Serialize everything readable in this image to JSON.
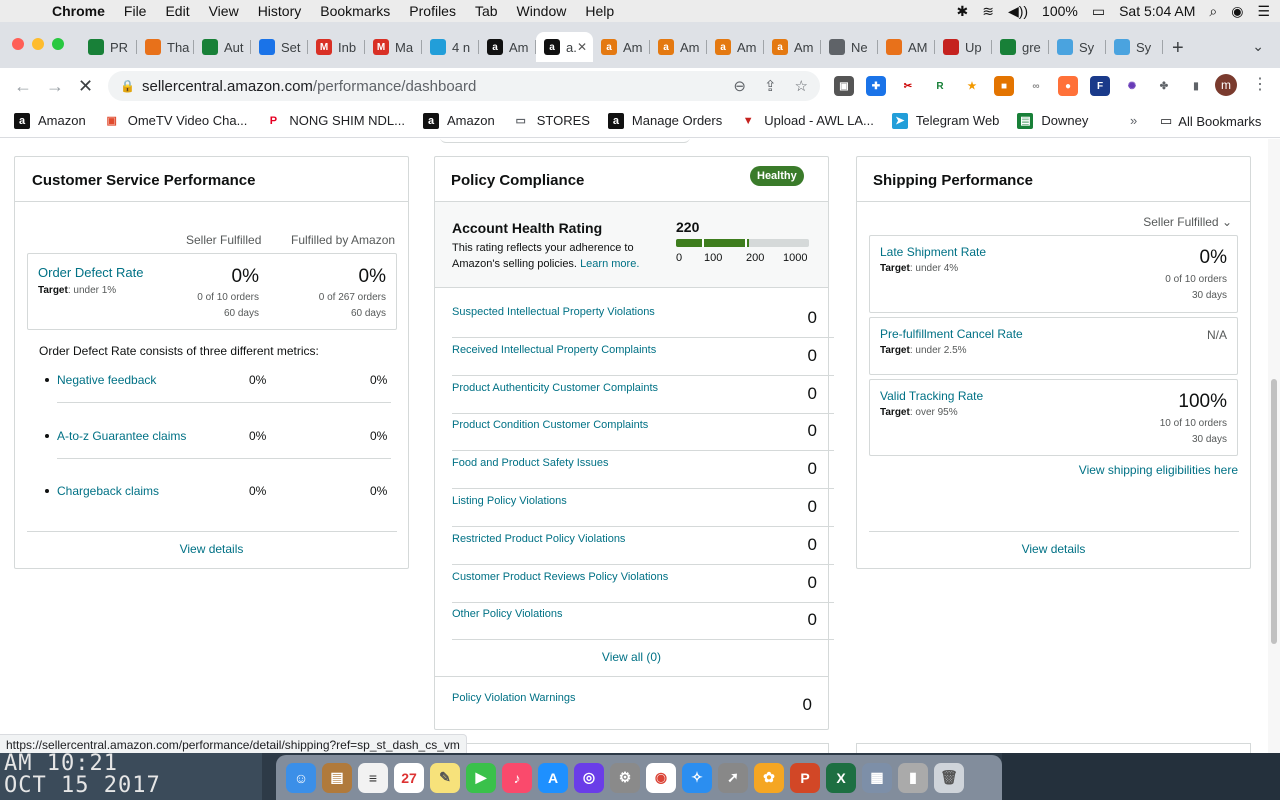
{
  "menubar": {
    "app": "Chrome",
    "items": [
      "File",
      "Edit",
      "View",
      "History",
      "Bookmarks",
      "Profiles",
      "Tab",
      "Window",
      "Help"
    ],
    "battery": "100%",
    "clock": "Sat 5:04 AM"
  },
  "tabs": [
    {
      "label": "PR",
      "icon": "sheets-icon",
      "color": "#188038"
    },
    {
      "label": "Tha",
      "icon": "pen-icon",
      "color": "#e8711a"
    },
    {
      "label": "Aut",
      "icon": "sheets-icon",
      "color": "#188038"
    },
    {
      "label": "Set",
      "icon": "gear-icon",
      "color": "#1a73e8"
    },
    {
      "label": "Inb",
      "icon": "gmail-icon",
      "color": "#d93025"
    },
    {
      "label": "Ma",
      "icon": "gmail-icon",
      "color": "#d93025"
    },
    {
      "label": "4 n",
      "icon": "telegram-icon",
      "color": "#229ed9"
    },
    {
      "label": "Am",
      "icon": "amazon-icon",
      "color": "#111111"
    },
    {
      "label": "a.",
      "icon": "amazon-icon",
      "color": "#111111",
      "active": true
    },
    {
      "label": "Am",
      "icon": "amazon-icon",
      "color": "#e47911"
    },
    {
      "label": "Am",
      "icon": "amazon-icon",
      "color": "#e47911"
    },
    {
      "label": "Am",
      "icon": "amazon-icon",
      "color": "#e47911"
    },
    {
      "label": "Am",
      "icon": "amazon-icon",
      "color": "#e47911"
    },
    {
      "label": "Ne",
      "icon": "globe-icon",
      "color": "#5f6368"
    },
    {
      "label": "AM",
      "icon": "pen-icon",
      "color": "#e8711a"
    },
    {
      "label": "Up",
      "icon": "upload-icon",
      "color": "#c5221f"
    },
    {
      "label": "gre",
      "icon": "sheets-icon",
      "color": "#188038"
    },
    {
      "label": "Sy",
      "icon": "sysco-icon",
      "color": "#4aa3df"
    },
    {
      "label": "Sy",
      "icon": "sysco-icon",
      "color": "#4aa3df"
    }
  ],
  "toolbar": {
    "url_host": "sellercentral.amazon.com",
    "url_path": "/performance/dashboard",
    "profile_initial": "m"
  },
  "bookmarks": [
    {
      "label": "Amazon",
      "icon": "amazon-icon"
    },
    {
      "label": "OmeTV Video Cha...",
      "icon": "video-icon"
    },
    {
      "label": "NONG SHIM NDL...",
      "icon": "pinterest-icon"
    },
    {
      "label": "Amazon",
      "icon": "amazon-icon"
    },
    {
      "label": "STORES",
      "icon": "folder-icon"
    },
    {
      "label": "Manage Orders",
      "icon": "amazon-icon"
    },
    {
      "label": "Upload - AWL LA...",
      "icon": "upload-icon"
    },
    {
      "label": "Telegram Web",
      "icon": "telegram-icon"
    },
    {
      "label": "Downey",
      "icon": "sheets-icon"
    }
  ],
  "bookmarks_all": "All Bookmarks",
  "customer_service": {
    "title": "Customer Service Performance",
    "col_seller": "Seller Fulfilled",
    "col_fba": "Fulfilled by Amazon",
    "odr_name": "Order Defect Rate",
    "odr_target_label": "Target",
    "odr_target_value": ": under 1%",
    "seller_pct": "0%",
    "seller_orders": "0 of 10 orders",
    "seller_days": "60 days",
    "fba_pct": "0%",
    "fba_orders": "0 of 267 orders",
    "fba_days": "60 days",
    "explain": "Order Defect Rate consists of three different metrics:",
    "metrics": [
      {
        "name": "Negative feedback",
        "seller": "0%",
        "fba": "0%"
      },
      {
        "name": "A-to-z Guarantee claims",
        "seller": "0%",
        "fba": "0%"
      },
      {
        "name": "Chargeback claims",
        "seller": "0%",
        "fba": "0%"
      }
    ],
    "view_details": "View details"
  },
  "policy": {
    "title": "Policy Compliance",
    "badge": "Healthy",
    "ahr_title": "Account Health Rating",
    "ahr_desc": "This rating reflects your adherence to Amazon's selling policies.",
    "ahr_learn": "Learn more.",
    "score": "220",
    "score_value": 220,
    "scale": [
      "0",
      "100",
      "200",
      "1000"
    ],
    "violations": [
      {
        "name": "Suspected Intellectual Property Violations",
        "count": "0"
      },
      {
        "name": "Received Intellectual Property Complaints",
        "count": "0"
      },
      {
        "name": "Product Authenticity Customer Complaints",
        "count": "0"
      },
      {
        "name": "Product Condition Customer Complaints",
        "count": "0"
      },
      {
        "name": "Food and Product Safety Issues",
        "count": "0"
      },
      {
        "name": "Listing Policy Violations",
        "count": "0"
      },
      {
        "name": "Restricted Product Policy Violations",
        "count": "0"
      },
      {
        "name": "Customer Product Reviews Policy Violations",
        "count": "0"
      },
      {
        "name": "Other Policy Violations",
        "count": "0"
      }
    ],
    "view_all": "View all (0)",
    "warnings_label": "Policy Violation Warnings",
    "warnings_count": "0"
  },
  "shipping": {
    "title": "Shipping Performance",
    "selector": "Seller Fulfilled",
    "late_name": "Late Shipment Rate",
    "late_target_label": "Target",
    "late_target_value": ": under 4%",
    "late_pct": "0%",
    "late_orders": "0 of 10 orders",
    "late_days": "30 days",
    "cancel_name": "Pre-fulfillment Cancel Rate",
    "cancel_target_label": "Target",
    "cancel_target_value": ": under 2.5%",
    "cancel_value": "N/A",
    "vtr_name": "Valid Tracking Rate",
    "vtr_target_label": "Target",
    "vtr_target_value": ": over 95%",
    "vtr_pct": "100%",
    "vtr_orders": "10 of 10 orders",
    "vtr_days": "30 days",
    "eligibility": "View shipping eligibilities here",
    "view_details": "View details"
  },
  "status_url": "https://sellercentral.amazon.com/performance/detail/shipping?ref=sp_st_dash_cs_vm",
  "desktop_clock_line1": "AM 10:21",
  "desktop_clock_line2": "OCT 15 2017"
}
